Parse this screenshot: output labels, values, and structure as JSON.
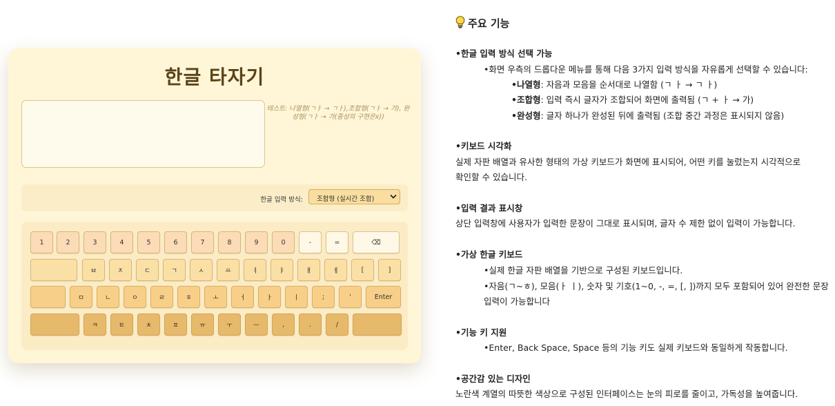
{
  "app": {
    "title": "한글 타자기",
    "input_value": "",
    "hint": "테스트: 나열형(ㄱㅏ → ㄱㅏ),조합형(ㄱㅏ → 가), 완성형(ㄱㅏ → 가(중성의 구현은x))",
    "mode_label": "한글 입력 방식:",
    "mode_selected": "조합형 (실시간 조합)"
  },
  "keyboard": {
    "row1": [
      "1",
      "2",
      "3",
      "4",
      "5",
      "6",
      "7",
      "8",
      "9",
      "0",
      "-",
      "=",
      "⌫"
    ],
    "row2": [
      "",
      "ㅂ",
      "ㅈ",
      "ㄷ",
      "ㄱ",
      "ㅅ",
      "ㅛ",
      "ㅕ",
      "ㅑ",
      "ㅐ",
      "ㅔ",
      "[",
      "]"
    ],
    "row3": [
      "",
      "ㅁ",
      "ㄴ",
      "ㅇ",
      "ㄹ",
      "ㅎ",
      "ㅗ",
      "ㅓ",
      "ㅏ",
      "ㅣ",
      ";",
      "'",
      "Enter"
    ],
    "row4": [
      "",
      "ㅋ",
      "ㅌ",
      "ㅊ",
      "ㅍ",
      "ㅠ",
      "ㅜ",
      "ㅡ",
      ",",
      ".",
      "/",
      ""
    ]
  },
  "doc": {
    "heading": "주요 기능",
    "s1_title": "•한글 입력 방식 선택 가능",
    "s1_intro": "•화면 우측의 드롭다운 메뉴를 통해 다음 3가지 입력 방식을 자유롭게 선택할 수 있습니다:",
    "s1_b1_label": "•나열형",
    "s1_b1_text": ": 자음과 모음을 순서대로 나열함 (ㄱ ㅏ → ㄱ ㅏ)",
    "s1_b2_label": "•조합형",
    "s1_b2_text": ": 입력 즉시 글자가 조합되어 화면에 출력됨 (ㄱ + ㅏ → 가)",
    "s1_b3_label": "•완성형",
    "s1_b3_text": ": 글자 하나가 완성된 뒤에 출력됨 (조합 중간 과정은 표시되지 않음)",
    "s2_title": "•키보드 시각화",
    "s2_line1": "실제 자판 배열과 유사한 형태의 가상 키보드가 화면에 표시되어, 어떤 키를 눌렀는지 시각적으로",
    "s2_line2": "확인할 수 있습니다.",
    "s3_title": "•입력 결과 표시창",
    "s3_line1": "상단 입력창에 사용자가 입력한 문장이 그대로 표시되며, 글자 수 제한 없이 입력이 가능합니다.",
    "s4_title": "•가상 한글 키보드",
    "s4_b1": "•실제 한글 자판 배열을 기반으로 구성된 키보드입니다.",
    "s4_b2_line1": "•자음(ㄱ~ㅎ), 모음(ㅏ ㅣ), 숫자 및 기호(1~0, -, =, [, ])까지 모두 포함되어 있어 완전한 문장",
    "s4_b2_line2": "입력이 가능합니다",
    "s5_title": "•기능 키 지원",
    "s5_b1": "•Enter, Back Space, Space 등의 기능 키도 실제 키보드와 동일하게 작동합니다.",
    "s6_title": "•공간감 있는 디자인",
    "s6_line1": "노란색 계열의 따뜻한 색상으로 구성된 인터페이스는 눈의 피로를 줄이고, 가독성을 높여줍니다."
  },
  "colors": {
    "card_bg": "#fff6d8",
    "title": "#5a4418",
    "row1": "#fbdcb7",
    "row2": "#fbe0a6",
    "row3": "#f8cf88",
    "row4": "#e7b96a"
  },
  "icons": {
    "heading_icon": "lightbulb-icon",
    "select_icon": "chevron-down-icon"
  }
}
